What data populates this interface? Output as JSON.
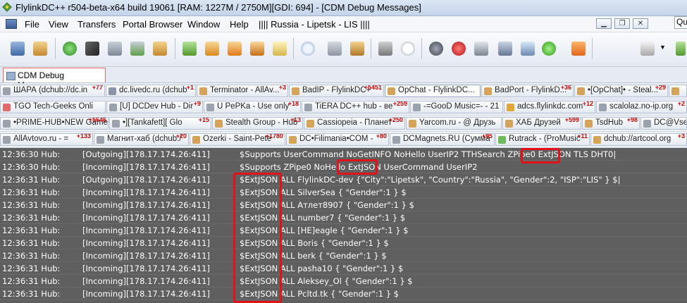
{
  "window": {
    "title": "FlylinkDC++ r504-beta-x64 build 19061 [RAM: 1227M / 2750M][GDI: 694] - [CDM Debug Messages]"
  },
  "menu": {
    "items": [
      "File",
      "View",
      "Transfers",
      "Portal Browser",
      "Window",
      "Help",
      "|||| Russia - Lipetsk - LIS ||||"
    ],
    "quick_search": "Quic"
  },
  "tab": {
    "label": "CDM Debug Messages"
  },
  "hub_rows": [
    [
      {
        "label": "ШАРА (dchub://dc.in",
        "badge": "+77"
      },
      {
        "label": "dc.livedc.ru (dchub",
        "badge": "+1"
      },
      {
        "label": "Terminator - AllAv...",
        "badge": "+3"
      },
      {
        "label": "BadIP - FlylinkDC+",
        "badge": "+5451"
      },
      {
        "label": "OpChat - FlylinkDC...",
        "badge": ""
      },
      {
        "label": "BadPort - FlylinkD...",
        "badge": "+36"
      },
      {
        "label": "•[OpChat]• - Steal...",
        "badge": "+29"
      },
      {
        "label": "",
        "badge": ""
      }
    ],
    [
      {
        "label": "TGO Tech-Geeks Onli",
        "badge": ""
      },
      {
        "label": "[U] DCDev Hub - Dir",
        "badge": "+9"
      },
      {
        "label": "U PePKa - Use only",
        "badge": "+18"
      },
      {
        "label": "TiERA DC++ hub - ве",
        "badge": "+259"
      },
      {
        "label": "-=GooD Music=- - 21",
        "badge": ""
      },
      {
        "label": "adcs.flylinkdc.com",
        "badge": "+12"
      },
      {
        "label": "scalolaz.no-ip.org",
        "badge": "+2"
      }
    ],
    [
      {
        "label": "•PRIME-HUB•NEW Game",
        "badge": "+5646"
      },
      {
        "label": "•][Tankafett][ Glo",
        "badge": "+15"
      },
      {
        "label": "Stealth Group - Hub",
        "badge": "+13"
      },
      {
        "label": "Cassiopeia - Планет",
        "badge": "+250"
      },
      {
        "label": "Yarcom.ru - @ Друзь",
        "badge": ""
      },
      {
        "label": "ХАБ Друзей",
        "badge": "+599"
      },
      {
        "label": "TsdHub",
        "badge": "+98"
      },
      {
        "label": "DC@Vsev",
        "badge": ""
      }
    ],
    [
      {
        "label": "AllAvtovo.ru - =",
        "badge": "+133"
      },
      {
        "label": "Магнит-хаб (dchub:/",
        "badge": "+20"
      },
      {
        "label": "Ozerki - Saint-Pete",
        "badge": "+1780"
      },
      {
        "label": "DC•Filimania•COM -",
        "badge": "+80"
      },
      {
        "label": "DCMagnets.RU (Сумма",
        "badge": "+95"
      },
      {
        "label": "Rutrack - (ProMusic",
        "badge": "+11"
      },
      {
        "label": "dchub://artcool.org",
        "badge": "+3"
      }
    ]
  ],
  "log_rows": [
    {
      "time": "12:36:30 Hub:",
      "dir": "[Outgoing][178.17.174.26:411]",
      "msg": "$Supports UserCommand NoGetINFO NoHello UserIP2 TTHSearch ZPipe0 ExtJSON TLS DHT0|"
    },
    {
      "time": "12:36:30 Hub:",
      "dir": "[Incoming][178.17.174.26:411]",
      "msg": "$Supports ZPipe0 NoHello ExtJSON UserCommand UserIP2"
    },
    {
      "time": "12:36:31 Hub:",
      "dir": "[Outgoing][178.17.174.26:411]",
      "msg": "$ExtJSON ALL FlylinkDC-dev {\"City\":\"Lipetsk\", \"Country\":\"Russia\", \"Gender\":2, \"ISP\":\"LIS\" } $|"
    },
    {
      "time": "12:36:31 Hub:",
      "dir": "[Incoming][178.17.174.26:411]",
      "msg": "$ExtJSON ALL SilverSea { \"Gender\":1 } $"
    },
    {
      "time": "12:36:31 Hub:",
      "dir": "[Incoming][178.17.174.26:411]",
      "msg": "$ExtJSON ALL Атлет8907 { \"Gender\":1 } $"
    },
    {
      "time": "12:36:31 Hub:",
      "dir": "[Incoming][178.17.174.26:411]",
      "msg": "$ExtJSON ALL number7 { \"Gender\":1 } $"
    },
    {
      "time": "12:36:31 Hub:",
      "dir": "[Incoming][178.17.174.26:411]",
      "msg": "$ExtJSON ALL [HE]eagle { \"Gender\":1 } $"
    },
    {
      "time": "12:36:31 Hub:",
      "dir": "[Incoming][178.17.174.26:411]",
      "msg": "$ExtJSON ALL Boris { \"Gender\":1 } $"
    },
    {
      "time": "12:36:31 Hub:",
      "dir": "[Incoming][178.17.174.26:411]",
      "msg": "$ExtJSON ALL berk { \"Gender\":1 } $"
    },
    {
      "time": "12:36:31 Hub:",
      "dir": "[Incoming][178.17.174.26:411]",
      "msg": "$ExtJSON ALL pasha10 { \"Gender\":1 } $"
    },
    {
      "time": "12:36:31 Hub:",
      "dir": "[Incoming][178.17.174.26:411]",
      "msg": "$ExtJSON ALL Aleksey_Ol { \"Gender\":1 } $"
    },
    {
      "time": "12:36:31 Hub:",
      "dir": "[Incoming][178.17.174.26:411]",
      "msg": "$ExtJSON ALL Pcltd.tk { \"Gender\":1 } $"
    }
  ],
  "colors": {
    "log_bg": "#5f5f5f",
    "highlight": "#e3111a",
    "badge": "#d00000"
  },
  "toolbar_icons": [
    "connect-user-icon",
    "favorite-users-icon",
    "public-hubs-icon",
    "reconnect-icon",
    "favorite-hubs-icon",
    "users-icon",
    "download-queue-icon",
    "finished-downloads-icon",
    "upload-queue-icon",
    "finished-uploads-icon",
    "notepad-icon",
    "search-icon",
    "adl-search-icon",
    "spy-icon",
    "network-stats-icon",
    "clock-icon",
    "limiter-icon",
    "record-icon",
    "refresh-share-icon",
    "settings-icon",
    "openssl-icon",
    "wizard-icon",
    "blogger-icon",
    "media-player-icon"
  ]
}
